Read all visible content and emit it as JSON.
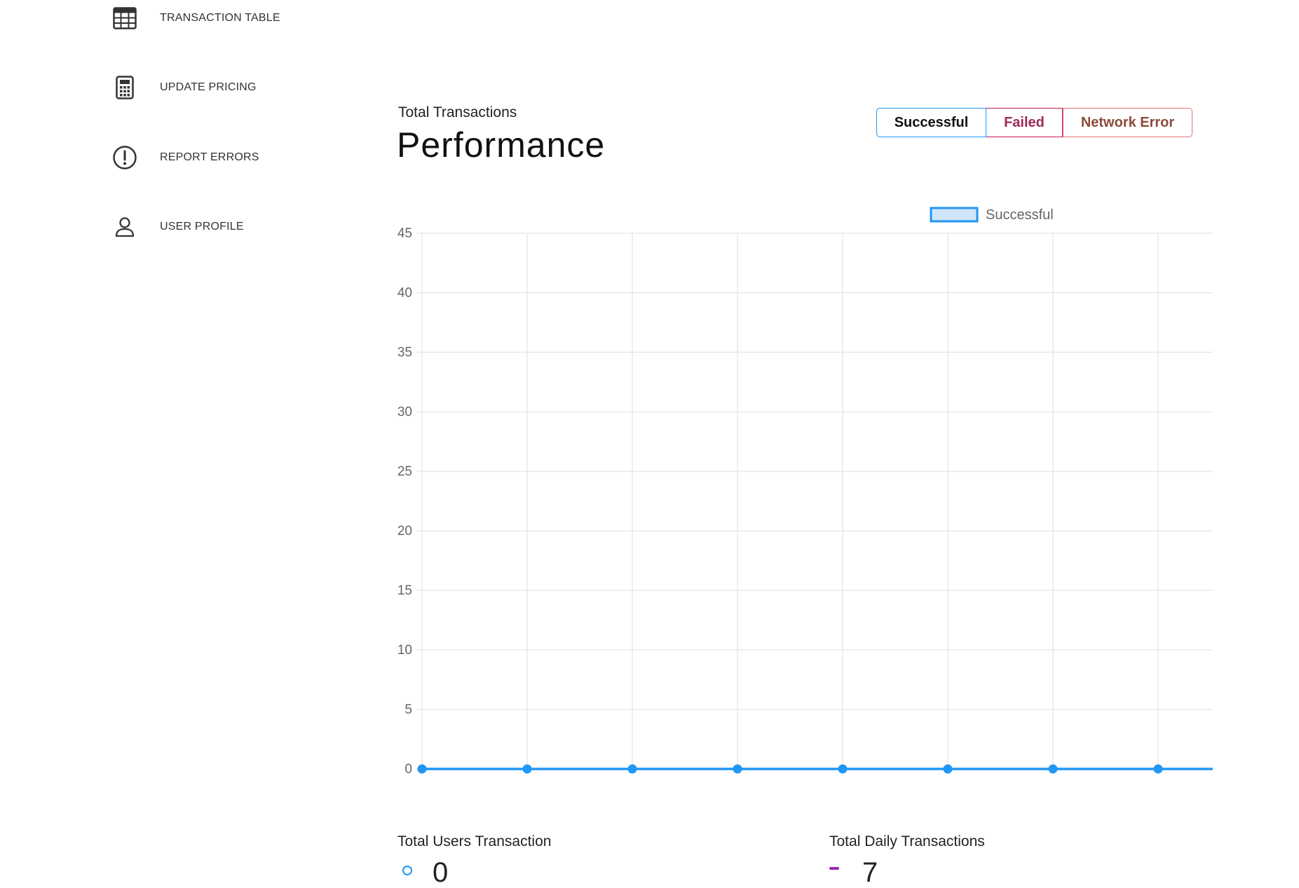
{
  "sidebar": {
    "items": [
      {
        "label": "TRANSACTION TABLE",
        "icon": "table-icon"
      },
      {
        "label": "UPDATE PRICING",
        "icon": "calculator-icon"
      },
      {
        "label": "REPORT ERRORS",
        "icon": "exclamation-circle-icon"
      },
      {
        "label": "USER PROFILE",
        "icon": "user-icon"
      }
    ]
  },
  "header": {
    "subtitle": "Total Transactions",
    "title": "Performance"
  },
  "filters": {
    "successful": "Successful",
    "failed": "Failed",
    "network_error": "Network Error",
    "active": "Successful"
  },
  "colors": {
    "successful": "#2196f3",
    "failed": "#c2185b",
    "network_error": "#e57373"
  },
  "chart_data": {
    "type": "line",
    "x": [
      "",
      "",
      "",
      "",
      "",
      "",
      "",
      ""
    ],
    "series": [
      {
        "name": "Successful",
        "values": [
          0,
          0,
          0,
          0,
          0,
          0,
          0,
          0
        ]
      }
    ],
    "ylim": [
      0,
      45
    ],
    "yticks": [
      0,
      5,
      10,
      15,
      20,
      25,
      30,
      35,
      40,
      45
    ],
    "grid": true,
    "legend": "top-right"
  },
  "stats": {
    "users_label": "Total Users Transaction",
    "users_value": "0",
    "daily_label": "Total Daily Transactions",
    "daily_value": "7"
  }
}
